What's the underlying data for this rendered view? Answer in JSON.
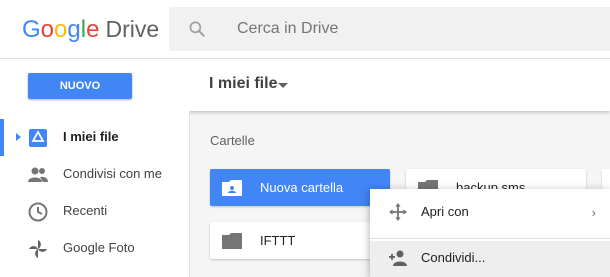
{
  "header": {
    "logo_letters": [
      "G",
      "o",
      "o",
      "g",
      "l",
      "e"
    ],
    "logo_product": "Drive",
    "search_placeholder": "Cerca in Drive"
  },
  "toolbar": {
    "new_label": "NUOVO",
    "breadcrumb": "I miei file"
  },
  "sidebar": {
    "items": [
      {
        "label": "I miei file",
        "icon": "drive-icon",
        "active": true
      },
      {
        "label": "Condivisi con me",
        "icon": "people-icon"
      },
      {
        "label": "Recenti",
        "icon": "clock-icon"
      },
      {
        "label": "Google Foto",
        "icon": "pinwheel-icon"
      }
    ]
  },
  "main": {
    "section_label": "Cartelle",
    "folders": [
      {
        "name": "Nuova cartella",
        "selected": true
      },
      {
        "name": "backup sms"
      },
      {
        "name": "IFTTT"
      }
    ]
  },
  "context_menu": {
    "items": [
      {
        "label": "Apri con",
        "icon": "move-icon",
        "submenu_arrow": "›"
      },
      {
        "label": "Condividi...",
        "icon": "add-person-icon",
        "hover": true
      }
    ]
  },
  "colors": {
    "accent": "#4285f4",
    "header_bg": "#ffffff",
    "page_bg": "#f5f5f5"
  }
}
